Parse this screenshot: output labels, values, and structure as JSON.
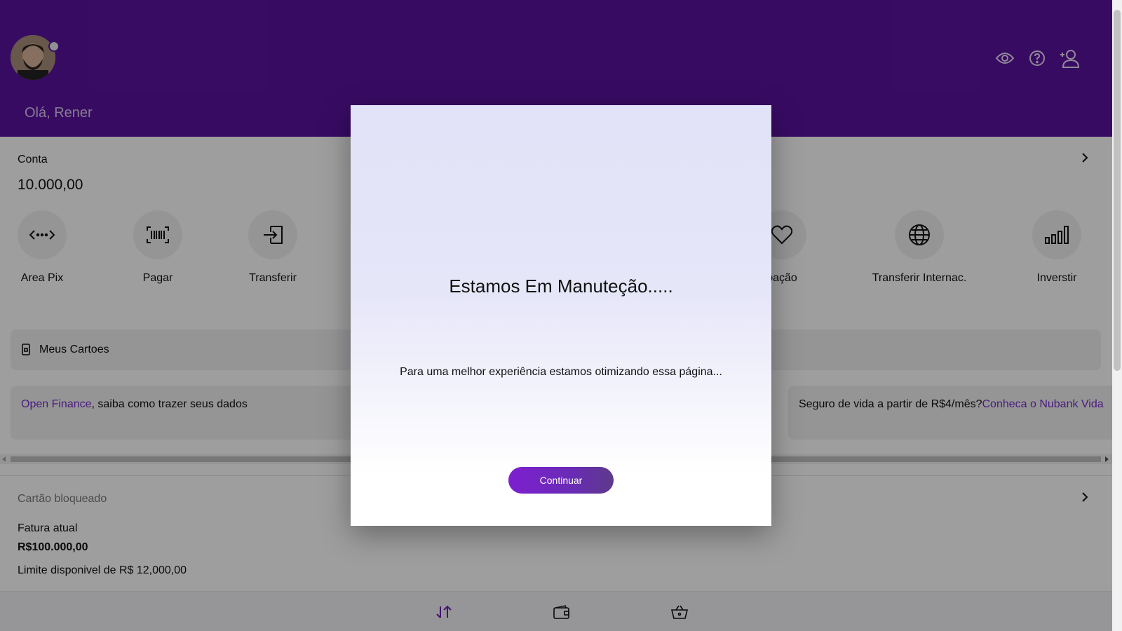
{
  "header": {
    "greeting": "Olá, Rener",
    "icons": [
      "eye-icon",
      "help-circle-icon",
      "add-user-icon"
    ],
    "background": "#5b13a0"
  },
  "account": {
    "title": "Conta",
    "balance": "10.000,00",
    "actions": [
      {
        "label": "Area Pix",
        "icon": "pix-icon"
      },
      {
        "label": "Pagar",
        "icon": "barcode-icon"
      },
      {
        "label": "Transferir",
        "icon": "transfer-icon"
      },
      {
        "label": "oação",
        "icon": "heart-icon"
      },
      {
        "label": "Transferir Internac.",
        "icon": "globe-icon"
      },
      {
        "label": "Inverstir",
        "icon": "bar-chart-icon"
      }
    ]
  },
  "cards_bar": {
    "label": "Meus Cartoes"
  },
  "promos": [
    {
      "link": "Open Finance",
      "text": ", saiba como trazer seus dados"
    },
    {
      "text": "Seguro de vida a partir de R$4/mês?",
      "link": "Conheca o Nubank Vida"
    }
  ],
  "credit_card": {
    "status": "Cartão bloqueado",
    "invoice_label": "Fatura atual",
    "invoice_value": "R$100.000,00",
    "limit": "Limite disponivel de R$ 12,000,00"
  },
  "bottom_nav": {
    "icons": [
      "transfer-arrows-icon",
      "wallet-icon",
      "shopping-basket-icon"
    ]
  },
  "modal": {
    "title": "Estamos Em Manuteção.....",
    "message": "Para uma melhor experiência estamos otimizando essa página...",
    "button_label": "Continuar",
    "accent": "#7d1fd0"
  }
}
